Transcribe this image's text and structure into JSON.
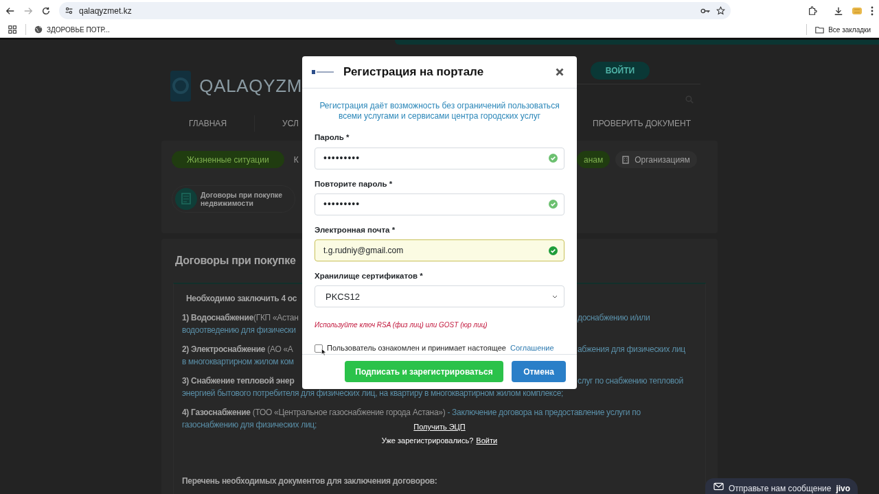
{
  "browser": {
    "url": "qalaqyzmet.kz",
    "bookmarks": [
      {
        "label": "ЗДОРОВЬЕ ПОТР..."
      }
    ],
    "all_bookmarks": "Все закладки"
  },
  "page": {
    "logo_text": "QALAQYZM",
    "login_button": "ВОЙТИ",
    "nav_left": [
      "ГЛАВНАЯ",
      "УСЛ"
    ],
    "nav_right": [
      "ПРОВЕРИТЬ ДОКУМЕНТ"
    ],
    "filters_left": [
      {
        "label": "Жизненные ситуации",
        "selected": true
      },
      {
        "label": "К",
        "selected": false
      }
    ],
    "filters_right": [
      {
        "label": "анам",
        "selected": true,
        "kind": "plain"
      },
      {
        "label": "Организациям",
        "selected": false,
        "kind": "building"
      }
    ],
    "category_card": "Договоры при покупке недвижимости",
    "section_title": "Договоры при покупке",
    "intro": "Необходимо заключить 4 ос",
    "paragraphs": [
      {
        "lines": [
          {
            "kind": "split",
            "left": [
              {
                "kind": "title",
                "text": "1) Водоснабжение"
              },
              {
                "kind": "provider",
                "text": "(ГКП «Астан"
              }
            ],
            "right": [
              {
                "kind": "link",
                "text": "доснабжению и/или"
              }
            ]
          },
          {
            "kind": "split",
            "left": [
              {
                "kind": "link",
                "text": "водоотведению для физически"
              }
            ]
          }
        ]
      },
      {
        "lines": [
          {
            "kind": "split",
            "left": [
              {
                "kind": "title",
                "text": "2) Электроснабжение"
              },
              {
                "kind": "provider",
                "text": " (АО «А"
              }
            ],
            "right": [
              {
                "kind": "link",
                "text": "абжения для физических лиц"
              }
            ]
          },
          {
            "kind": "split",
            "left": [
              {
                "kind": "link",
                "text": "в многоквартирном жилом ком"
              }
            ]
          }
        ]
      },
      {
        "lines": [
          {
            "kind": "split",
            "left": [
              {
                "kind": "title",
                "text": "3) Снабжение тепловой энер"
              }
            ],
            "right": [
              {
                "kind": "link",
                "text": "слуг по снабжению тепловой"
              }
            ]
          },
          {
            "kind": "full",
            "left": [
              {
                "kind": "link",
                "text": "энергией бытового потребителя для физических лиц, на квартиру в многоквартирном жилом комплексе;"
              }
            ]
          }
        ]
      },
      {
        "lines": [
          {
            "kind": "full",
            "left": [
              {
                "kind": "title",
                "text": "4) Газоснабжение"
              },
              {
                "kind": "provider",
                "text": " (ТОО «Центральное газоснабжение города Астана»)"
              },
              {
                "kind": "link",
                "text": " - Заключение договора на предоставление услуги по"
              }
            ]
          },
          {
            "kind": "full",
            "left": [
              {
                "kind": "link",
                "text": "газоснабжению для физических лиц;"
              }
            ]
          }
        ]
      }
    ],
    "documents_heading": "Перечень необходимых документов для заключения договоров:",
    "chat": {
      "label": "Отправьте нам сообщение",
      "brand": "jivo"
    }
  },
  "modal": {
    "title": "Регистрация на портале",
    "intro": "Регистрация даёт возможность без ограничений пользоваться всеми услугами и сервисами центра городских услуг",
    "fields": [
      {
        "kind": "password",
        "label": "Пароль *",
        "value": "•••••••••",
        "valid": true,
        "autofilled": false
      },
      {
        "kind": "password",
        "label": "Повторите пароль *",
        "value": "•••••••••",
        "valid": true,
        "autofilled": false
      },
      {
        "kind": "text",
        "label": "Электронная почта *",
        "value": "t.g.rudniy@gmail.com",
        "valid": true,
        "autofilled": true
      },
      {
        "kind": "select",
        "label": "Хранилище сертификатов *",
        "value": "PKCS12",
        "valid": false,
        "autofilled": false
      }
    ],
    "hint": "Используйте ключ RSA (физ лиц) или GOST (юр лиц)",
    "agreement": {
      "text": "Пользователь ознакомлен и принимает настоящее",
      "link": "Соглашение",
      "checked": false
    },
    "buttons": [
      {
        "label": "Подписать и зарегистрироваться",
        "kind": "primary"
      },
      {
        "label": "Отмена",
        "kind": "secondary"
      }
    ],
    "get_signature_link": "Получить ЭЦП",
    "already_registered": "Уже зарегистрировались?",
    "login_link": "Войти"
  }
}
